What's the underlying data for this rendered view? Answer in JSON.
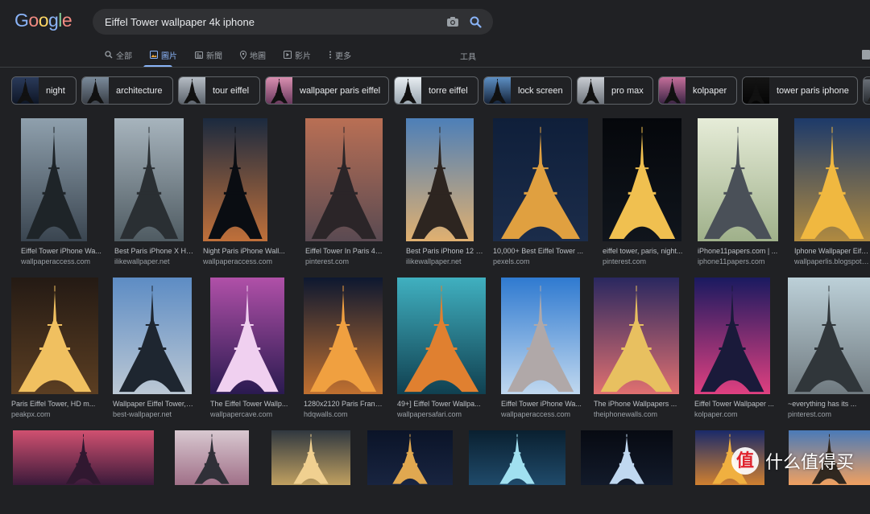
{
  "logo": {
    "text": "Google",
    "letters": [
      "G",
      "o",
      "o",
      "g",
      "l",
      "e"
    ],
    "colors": [
      "#8ab4f8",
      "#f28b82",
      "#fdd663",
      "#8ab4f8",
      "#81c995",
      "#f28b82"
    ]
  },
  "search": {
    "query": "Eiffel Tower wallpaper 4k iphone",
    "camera_icon": "camera-icon",
    "search_icon": "search-icon"
  },
  "tabs": [
    {
      "label": "全部",
      "icon": "search-icon",
      "active": false
    },
    {
      "label": "圖片",
      "icon": "image-icon",
      "active": true
    },
    {
      "label": "新聞",
      "icon": "news-icon",
      "active": false
    },
    {
      "label": "地圖",
      "icon": "map-pin-icon",
      "active": false
    },
    {
      "label": "影片",
      "icon": "play-icon",
      "active": false
    },
    {
      "label": "更多",
      "icon": "more-vert-icon",
      "active": false
    }
  ],
  "tools_label": "工具",
  "chips": [
    {
      "label": "night",
      "palette": [
        "#2a3a5a",
        "#0e1626"
      ]
    },
    {
      "label": "architecture",
      "palette": [
        "#7a8a9a",
        "#3a3f47"
      ]
    },
    {
      "label": "tour eiffel",
      "palette": [
        "#b5bcc4",
        "#5d646d"
      ]
    },
    {
      "label": "wallpaper paris eiffel",
      "palette": [
        "#d98fb0",
        "#6a3a5e"
      ]
    },
    {
      "label": "torre eiffel",
      "palette": [
        "#e8eef2",
        "#9aa6b0"
      ]
    },
    {
      "label": "lock screen",
      "palette": [
        "#5d8fc4",
        "#142238"
      ]
    },
    {
      "label": "pro max",
      "palette": [
        "#c8ccd2",
        "#6e747c"
      ]
    },
    {
      "label": "kolpaper",
      "palette": [
        "#c46e9a",
        "#3b2544"
      ]
    },
    {
      "label": "tower paris iphone",
      "palette": [
        "#151515",
        "#050505"
      ]
    }
  ],
  "results": [
    {
      "title": "Eiffel Tower iPhone Wa...",
      "source": "wallpaperaccess.com",
      "sky": [
        "#8fa0ad",
        "#3a4550"
      ],
      "tower": "#1e2428"
    },
    {
      "title": "Best Paris iPhone X HD...",
      "source": "ilikewallpaper.net",
      "sky": [
        "#a7b4bd",
        "#4f5b62"
      ],
      "tower": "#2a2f33"
    },
    {
      "title": "Night Paris iPhone Wall...",
      "source": "wallpaperaccess.com",
      "sky": [
        "#1b2a3f",
        "#c0703a"
      ],
      "tower": "#0a0d12"
    },
    {
      "title": "Eiffel Tower In Paris 4k...",
      "source": "pinterest.com",
      "sky": [
        "#b96f54",
        "#5a4a52"
      ],
      "tower": "#2b2528"
    },
    {
      "title": "Best Paris iPhone 12 H...",
      "source": "ilikewallpaper.net",
      "sky": [
        "#4d7fb8",
        "#e0b070"
      ],
      "tower": "#2d2520"
    },
    {
      "title": "10,000+ Best Eiffel Tower ...",
      "source": "pexels.com",
      "sky": [
        "#0f1f3a",
        "#1b2c4a"
      ],
      "tower": "#e0a040"
    },
    {
      "title": "eiffel tower, paris, night...",
      "source": "pinterest.com",
      "sky": [
        "#05070b",
        "#10151c"
      ],
      "tower": "#f0c050"
    },
    {
      "title": "iPhone11papers.com | ...",
      "source": "iphone11papers.com",
      "sky": [
        "#e6ecd8",
        "#9fb08a"
      ],
      "tower": "#4a5058"
    },
    {
      "title": "Iphone Wallpaper Eiffel...",
      "source": "wallpaperlis.blogspot.c...",
      "sky": [
        "#1d3a6a",
        "#b08a40"
      ],
      "tower": "#f0b840"
    },
    {
      "title": "Paris Eiffel Tower, HD m...",
      "source": "peakpx.com",
      "sky": [
        "#241a14",
        "#5b3e22"
      ],
      "tower": "#f0c060"
    },
    {
      "title": "Wallpaper Eiffel Tower, ...",
      "source": "best-wallpaper.net",
      "sky": [
        "#5d8cc4",
        "#bcc8d4"
      ],
      "tower": "#1e2630"
    },
    {
      "title": "The Eiffel Tower Wallp...",
      "source": "wallpapercave.com",
      "sky": [
        "#b050a8",
        "#2a1a50"
      ],
      "tower": "#f0d0f0"
    },
    {
      "title": "1280x2120 Paris Franc...",
      "source": "hdqwalls.com",
      "sky": [
        "#0d1830",
        "#c07030"
      ],
      "tower": "#f0a040"
    },
    {
      "title": "49+] Eiffel Tower Wallpa...",
      "source": "wallpapersafari.com",
      "sky": [
        "#40b0c0",
        "#104050"
      ],
      "tower": "#e08030"
    },
    {
      "title": "Eiffel Tower iPhone Wa...",
      "source": "wallpaperaccess.com",
      "sky": [
        "#2f7ad0",
        "#c0d8ef"
      ],
      "tower": "#b0a8a8"
    },
    {
      "title": "The iPhone Wallpapers ...",
      "source": "theiphonewalls.com",
      "sky": [
        "#2a2860",
        "#e07070"
      ],
      "tower": "#e8c060"
    },
    {
      "title": "Eiffel Tower Wallpaper ...",
      "source": "kolpaper.com",
      "sky": [
        "#1a1a60",
        "#e04080"
      ],
      "tower": "#1a1a3a"
    },
    {
      "title": "~everything has its ...",
      "source": "pinterest.com",
      "sky": [
        "#bcd0d8",
        "#707a80"
      ],
      "tower": "#30363a"
    },
    {
      "title": "",
      "source": "",
      "sky": [
        "#d05070",
        "#3a1a3a"
      ],
      "tower": "#301830"
    },
    {
      "title": "",
      "source": "",
      "sky": [
        "#d8c8d0",
        "#a07088"
      ],
      "tower": "#303038"
    },
    {
      "title": "",
      "source": "",
      "sky": [
        "#303840",
        "#c0a060"
      ],
      "tower": "#f0d090"
    },
    {
      "title": "",
      "source": "",
      "sky": [
        "#0b1428",
        "#182440"
      ],
      "tower": "#e0a850"
    },
    {
      "title": "",
      "source": "",
      "sky": [
        "#0a2030",
        "#1f4a6a"
      ],
      "tower": "#a0e0f0"
    },
    {
      "title": "",
      "source": "",
      "sky": [
        "#070a12",
        "#121a2a"
      ],
      "tower": "#c0d8f0"
    },
    {
      "title": "",
      "source": "",
      "sky": [
        "#1a2a6a",
        "#d08030"
      ],
      "tower": "#f0b040"
    },
    {
      "title": "",
      "source": "",
      "sky": [
        "#4a7ab8",
        "#f0a060"
      ],
      "tower": "#302820"
    }
  ],
  "watermark": {
    "badge": "值",
    "text": "什么值得买"
  }
}
